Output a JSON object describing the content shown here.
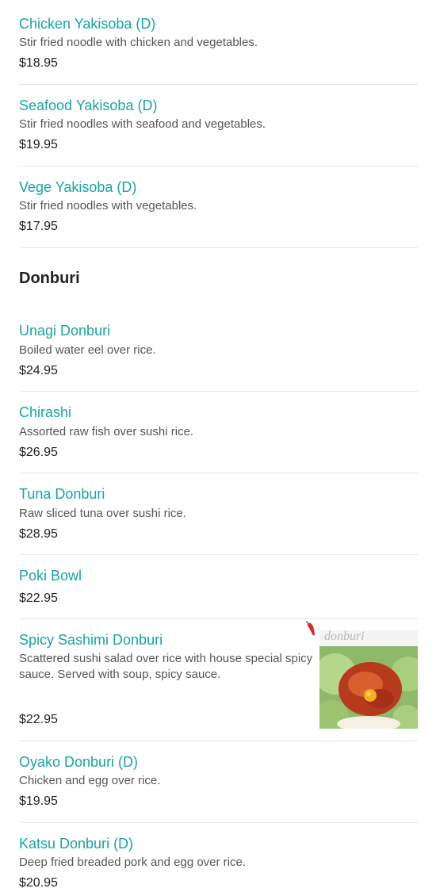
{
  "section": {
    "title": "Donburi"
  },
  "items": [
    {
      "name": "Chicken Yakisoba (D)",
      "desc": "Stir fried noodle with chicken and vegetables.",
      "price": "$18.95"
    },
    {
      "name": "Seafood Yakisoba (D)",
      "desc": "Stir fried noodles with seafood and vegetables.",
      "price": "$19.95"
    },
    {
      "name": "Vege Yakisoba (D)",
      "desc": "Stir fried noodles with vegetables.",
      "price": "$17.95"
    },
    {
      "name": "Unagi Donburi",
      "desc": "Boiled water eel over rice.",
      "price": "$24.95"
    },
    {
      "name": "Chirashi",
      "desc": "Assorted raw fish over sushi rice.",
      "price": "$26.95"
    },
    {
      "name": "Tuna Donburi",
      "desc": "Raw sliced tuna over sushi rice.",
      "price": "$28.95"
    },
    {
      "name": "Poki Bowl",
      "desc": "",
      "price": "$22.95"
    },
    {
      "name": "Spicy Sashimi Donburi",
      "desc": "Scattered sushi salad over rice with house special spicy sauce. Served with soup, spicy sauce.",
      "price": "$22.95",
      "spicy_icon": "chili-pepper-icon",
      "image_caption": "donburi"
    },
    {
      "name": "Oyako Donburi (D)",
      "desc": "Chicken and egg over rice.",
      "price": "$19.95"
    },
    {
      "name": "Katsu Donburi (D)",
      "desc": "Deep fried breaded pork and egg over rice.",
      "price": "$20.95"
    }
  ]
}
